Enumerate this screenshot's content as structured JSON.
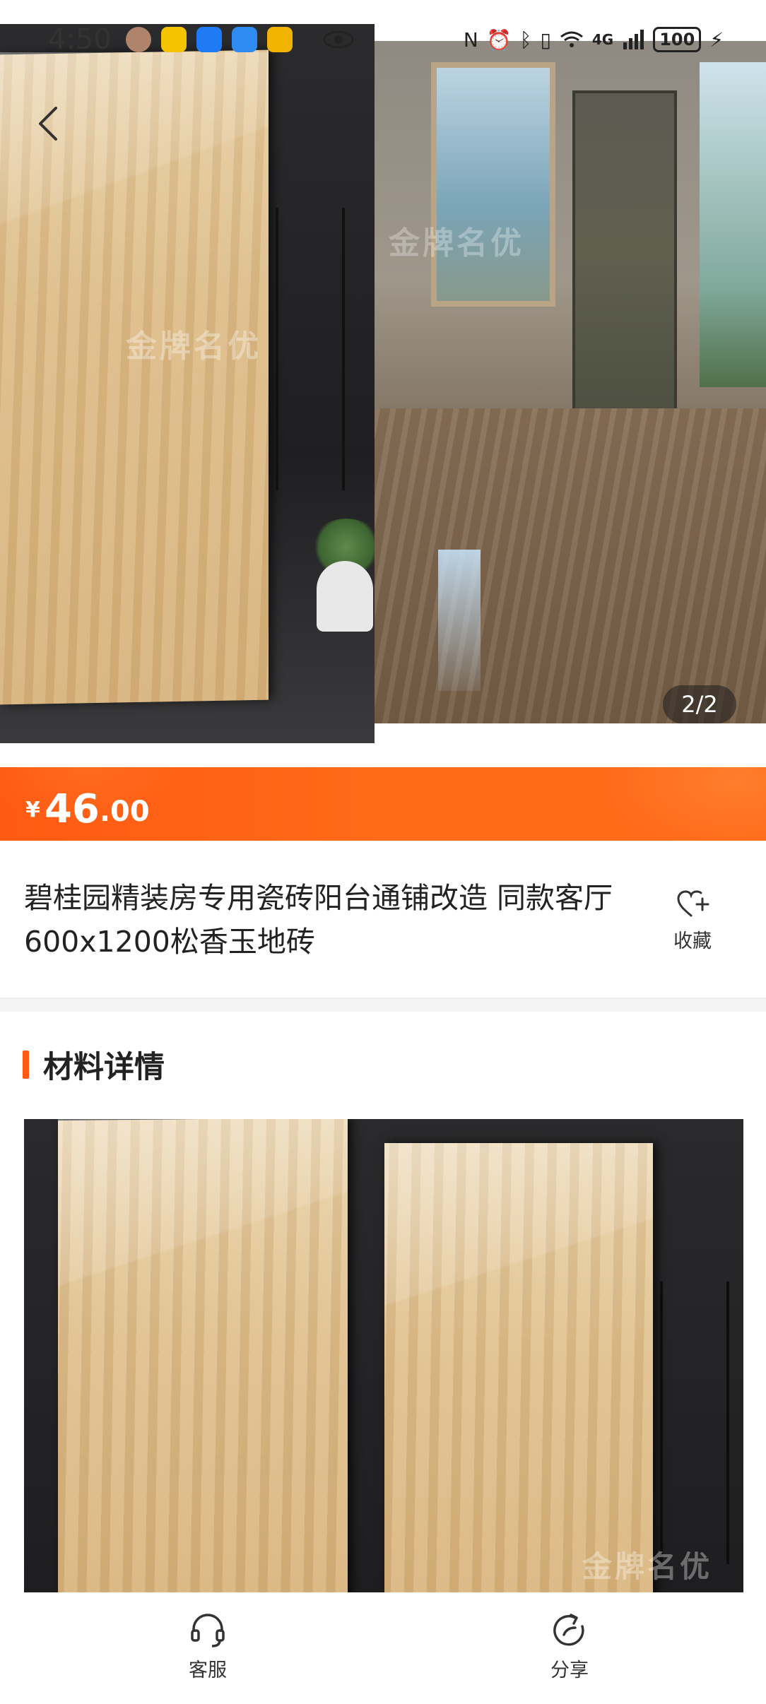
{
  "status_bar": {
    "time": "4:50",
    "network": "4G",
    "battery": "100",
    "signal_icon": "signal-bars-icon"
  },
  "gallery": {
    "counter": "2/2",
    "watermark_1": "金牌名优",
    "watermark_2": "金牌名优"
  },
  "price": {
    "currency": "¥",
    "integer": "46",
    "decimal": ".00"
  },
  "product": {
    "title": "碧桂园精装房专用瓷砖阳台通铺改造 同款客厅600x1200松香玉地砖",
    "favorite_label": "收藏"
  },
  "details": {
    "section_title": "材料详情",
    "watermark": "金牌名优"
  },
  "bottom_bar": {
    "service_label": "客服",
    "share_label": "分享"
  },
  "colors": {
    "accent": "#ff5a12",
    "price_bar": "#ff6a18"
  }
}
